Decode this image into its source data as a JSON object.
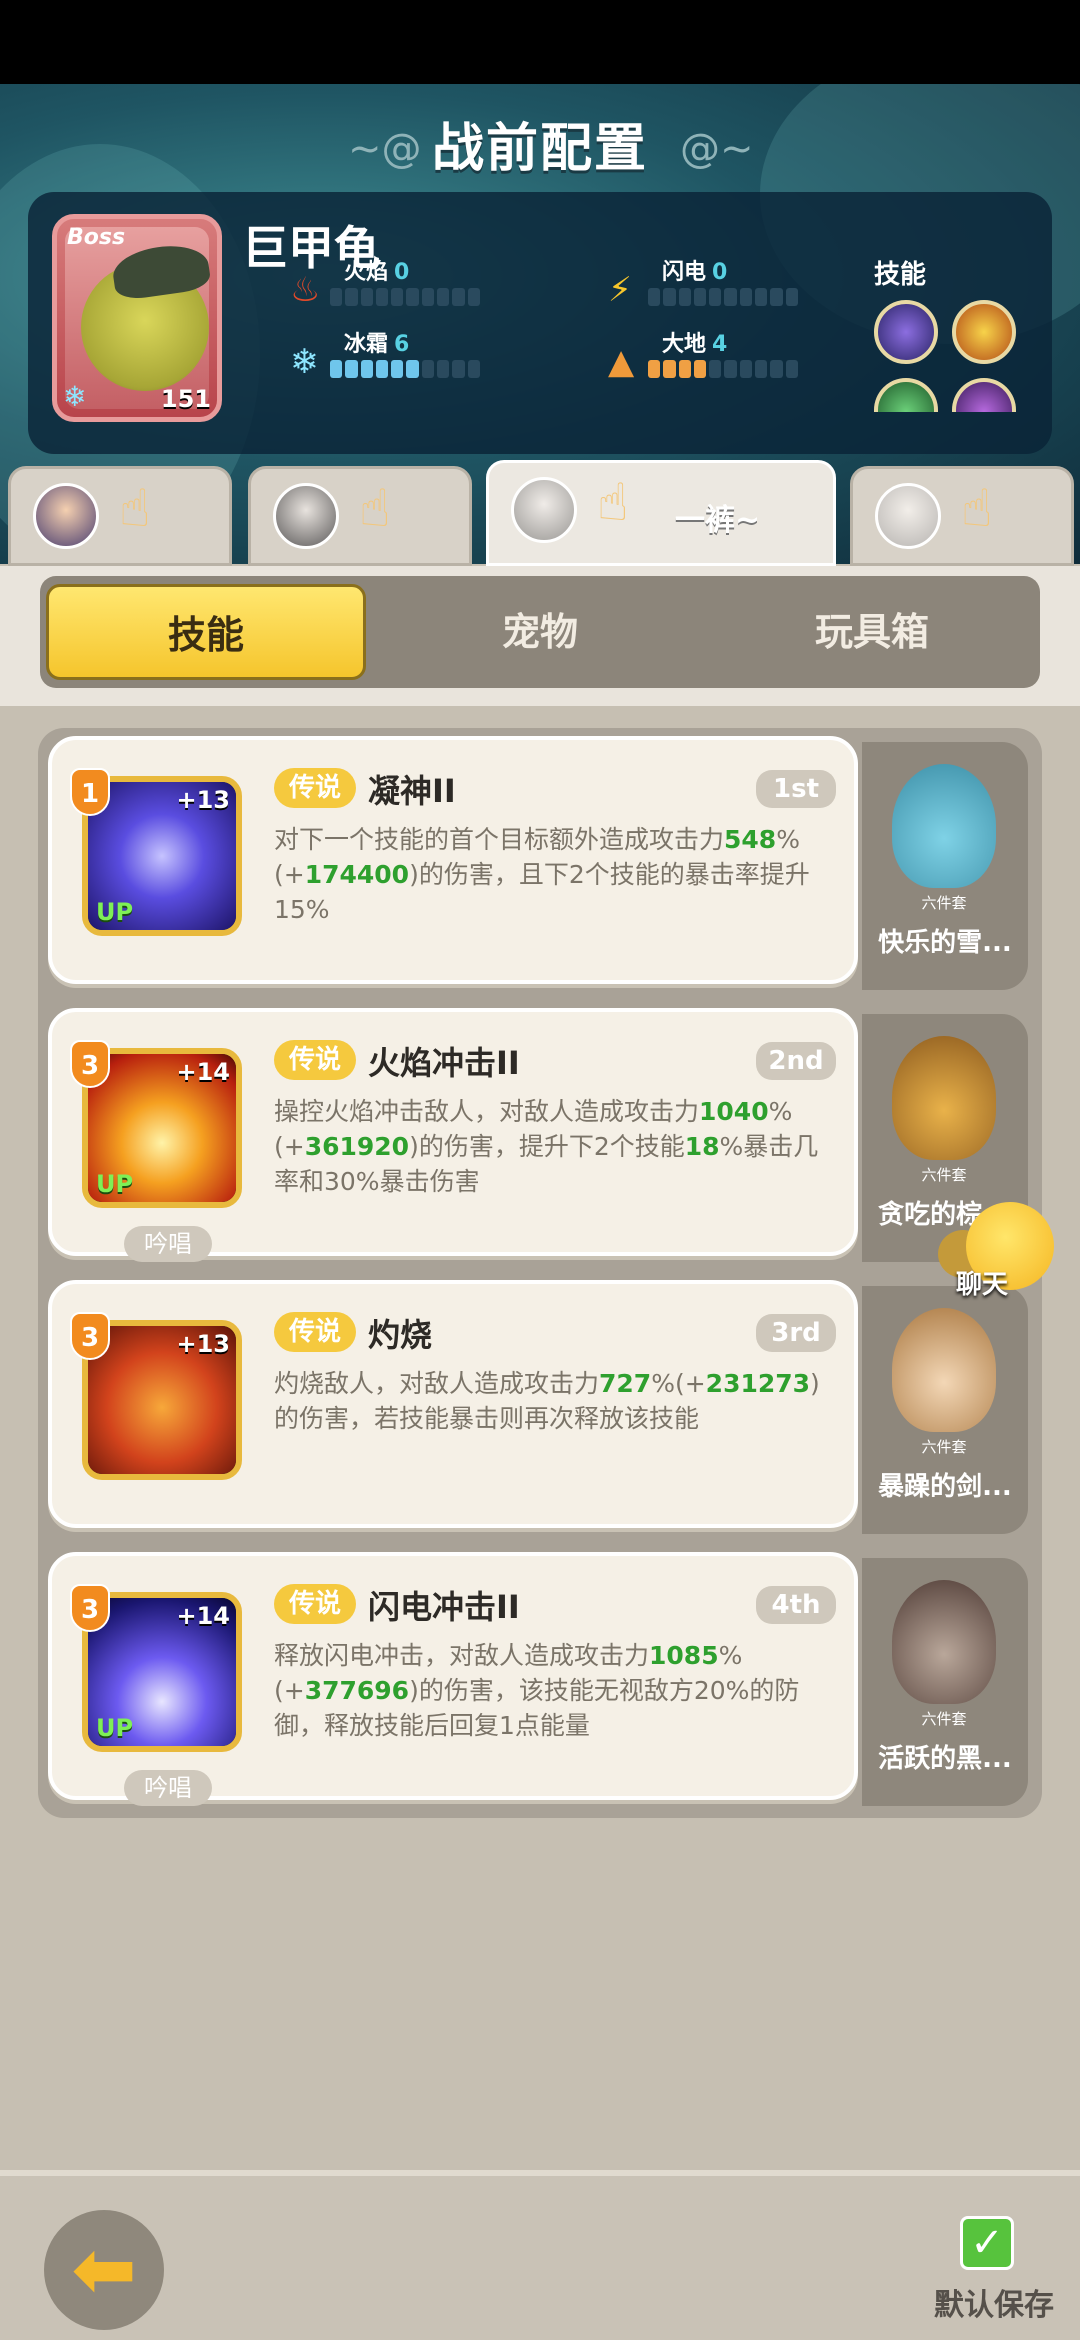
{
  "page_title": "战前配置",
  "boss": {
    "tag": "Boss",
    "name": "巨甲龟",
    "level": "151",
    "stats": [
      {
        "label": "火焰",
        "value": "0",
        "icon": "fire-icon",
        "level": 0
      },
      {
        "label": "闪电",
        "value": "0",
        "icon": "lightning-icon",
        "level": 0
      },
      {
        "label": "冰霜",
        "value": "6",
        "icon": "frost-icon",
        "level": 6
      },
      {
        "label": "大地",
        "value": "4",
        "icon": "earth-icon",
        "level": 4
      }
    ],
    "skills_label": "技能"
  },
  "char_tabs": [
    {
      "name": ""
    },
    {
      "name": ""
    },
    {
      "name": "一裤~"
    },
    {
      "name": ""
    }
  ],
  "segments": [
    "技能",
    "宠物",
    "玩具箱"
  ],
  "cards": [
    {
      "level": "1",
      "plus": "+13",
      "up": "UP",
      "badge": "传说",
      "name": "凝神II",
      "rank": "1st",
      "desc_parts": [
        "对下一个技能的首个目标额外造成攻击力",
        "548",
        "%(+",
        "174400",
        ")的伤害，且下2个技能的暴击率提升15%"
      ],
      "chant": "",
      "pet_set": "六件套",
      "pet_name": "快乐的雪..."
    },
    {
      "level": "3",
      "plus": "+14",
      "up": "UP",
      "badge": "传说",
      "name": "火焰冲击II",
      "rank": "2nd",
      "desc_parts": [
        "操控火焰冲击敌人，对敌人造成攻击力",
        "1040",
        "%(+",
        "361920",
        ")的伤害，提升下2个技能",
        "18",
        "%暴击几率和30%暴击伤害"
      ],
      "chant": "吟唱",
      "pet_set": "六件套",
      "pet_name": "贪吃的棕..."
    },
    {
      "level": "3",
      "plus": "+13",
      "up": "",
      "badge": "传说",
      "name": "灼烧",
      "rank": "3rd",
      "desc_parts": [
        "灼烧敌人，对敌人造成攻击力",
        "727",
        "%(+",
        "231273",
        ")的伤害，若技能暴击则再次释放该技能"
      ],
      "chant": "",
      "pet_set": "六件套",
      "pet_name": "暴躁的剑..."
    },
    {
      "level": "3",
      "plus": "+14",
      "up": "UP",
      "badge": "传说",
      "name": "闪电冲击II",
      "rank": "4th",
      "desc_parts": [
        "释放闪电冲击，对敌人造成攻击力",
        "1085",
        "%(+",
        "377696",
        ")的伤害，该技能无视敌方20%的防御，释放技能后回复1点能量"
      ],
      "chant": "吟唱",
      "pet_set": "六件套",
      "pet_name": "活跃的黑..."
    }
  ],
  "chat_label": "聊天",
  "save_label": "默认保存",
  "colors": {
    "accent": "#f5c93e",
    "highlight": "#2ea02e",
    "header_bg": "#1f5563"
  }
}
